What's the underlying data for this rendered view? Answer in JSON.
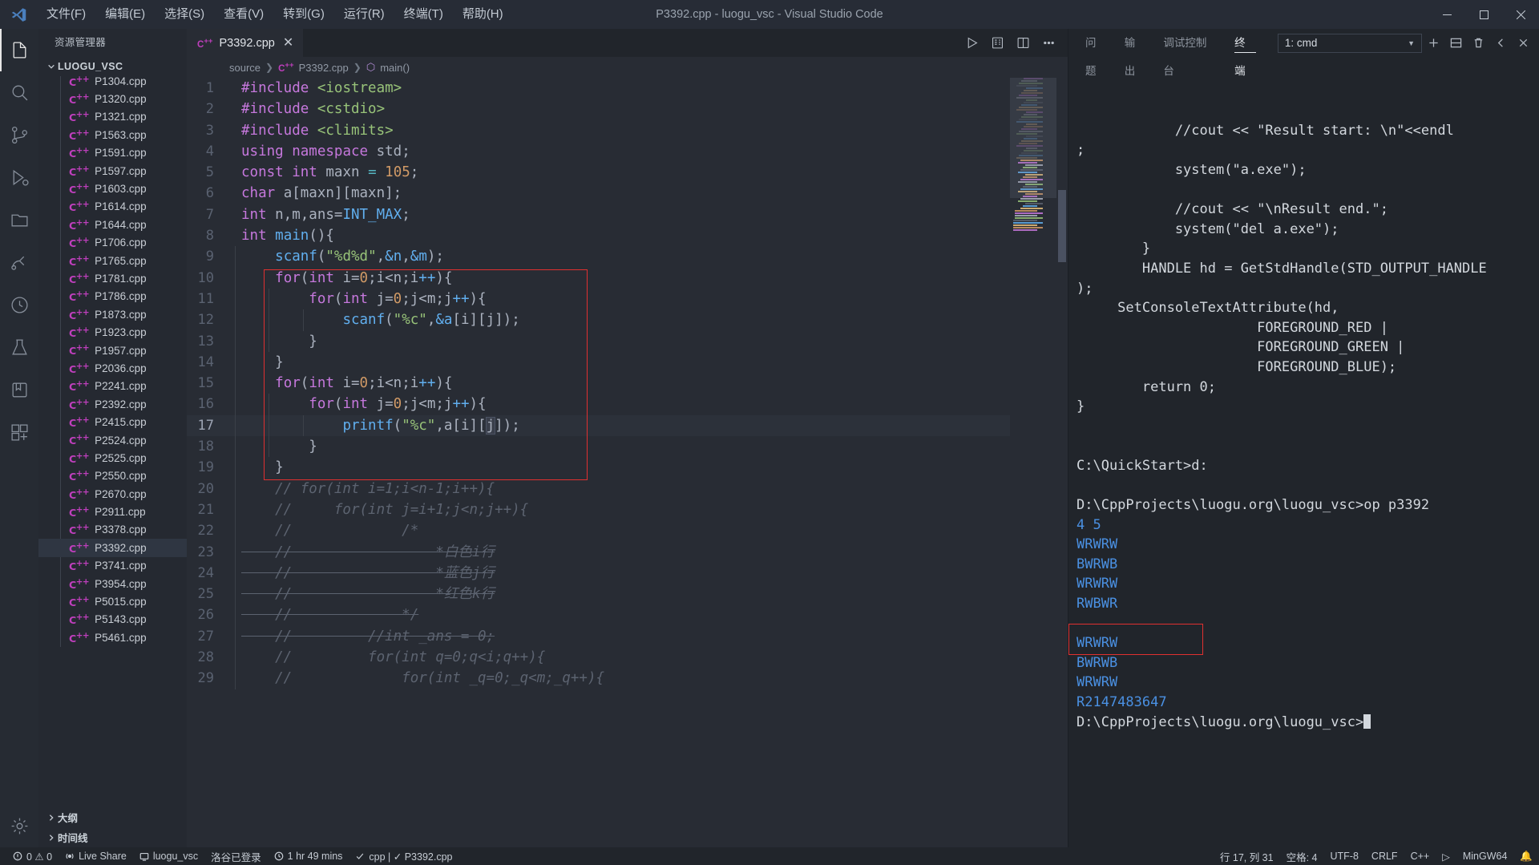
{
  "titlebar": {
    "title": "P3392.cpp - luogu_vsc - Visual Studio Code",
    "menus": [
      "文件(F)",
      "编辑(E)",
      "选择(S)",
      "查看(V)",
      "转到(G)",
      "运行(R)",
      "终端(T)",
      "帮助(H)"
    ],
    "window_controls": [
      "minimize",
      "maximize",
      "close"
    ]
  },
  "activitybar": {
    "items": [
      {
        "name": "explorer",
        "icon": "files-icon",
        "active": true
      },
      {
        "name": "search",
        "icon": "search-icon",
        "active": false
      },
      {
        "name": "source-control",
        "icon": "source-control-icon",
        "active": false
      },
      {
        "name": "run-debug",
        "icon": "run-debug-icon",
        "active": false
      },
      {
        "name": "remote-explorer",
        "icon": "folder-remote-icon",
        "active": false
      },
      {
        "name": "live-share",
        "icon": "live-share-icon",
        "active": false
      },
      {
        "name": "timeline",
        "icon": "clock-icon",
        "active": false
      },
      {
        "name": "testing",
        "icon": "beaker-icon",
        "active": false
      },
      {
        "name": "bookmarks",
        "icon": "bookmark-icon",
        "active": false
      },
      {
        "name": "extensions",
        "icon": "extensions-icon",
        "active": false
      },
      {
        "name": "settings",
        "icon": "gear-icon",
        "active": false
      }
    ]
  },
  "sidebar": {
    "title": "资源管理器",
    "root": "LUOGU_VSC",
    "files": [
      "P1304.cpp",
      "P1320.cpp",
      "P1321.cpp",
      "P1563.cpp",
      "P1591.cpp",
      "P1597.cpp",
      "P1603.cpp",
      "P1614.cpp",
      "P1644.cpp",
      "P1706.cpp",
      "P1765.cpp",
      "P1781.cpp",
      "P1786.cpp",
      "P1873.cpp",
      "P1923.cpp",
      "P1957.cpp",
      "P2036.cpp",
      "P2241.cpp",
      "P2392.cpp",
      "P2415.cpp",
      "P2524.cpp",
      "P2525.cpp",
      "P2550.cpp",
      "P2670.cpp",
      "P2911.cpp",
      "P3378.cpp",
      "P3392.cpp",
      "P3741.cpp",
      "P3954.cpp",
      "P5015.cpp",
      "P5143.cpp",
      "P5461.cpp"
    ],
    "selected_file": "P3392.cpp",
    "sections": [
      "大纲",
      "时间线"
    ]
  },
  "editor": {
    "tab": {
      "label": "P3392.cpp",
      "icon": "cpp-file-icon",
      "close": "✕"
    },
    "tab_actions": [
      "run-code-button",
      "split-preview-button",
      "split-editor-button",
      "more-actions-button"
    ],
    "breadcrumb": [
      "source",
      "P3392.cpp",
      "main()"
    ],
    "current_line_number": 17,
    "lines": [
      {
        "n": 1,
        "tokens": [
          {
            "t": "#include",
            "c": "pre"
          },
          {
            "t": " ",
            "c": "pl"
          },
          {
            "t": "<iostream>",
            "c": "str"
          }
        ]
      },
      {
        "n": 2,
        "tokens": [
          {
            "t": "#include",
            "c": "pre"
          },
          {
            "t": " ",
            "c": "pl"
          },
          {
            "t": "<cstdio>",
            "c": "str"
          }
        ]
      },
      {
        "n": 3,
        "tokens": [
          {
            "t": "#include",
            "c": "pre"
          },
          {
            "t": " ",
            "c": "pl"
          },
          {
            "t": "<climits>",
            "c": "str"
          }
        ]
      },
      {
        "n": 4,
        "tokens": [
          {
            "t": "using",
            "c": "k"
          },
          {
            "t": " ",
            "c": "pl"
          },
          {
            "t": "namespace",
            "c": "k"
          },
          {
            "t": " std;",
            "c": "pl"
          }
        ]
      },
      {
        "n": 5,
        "tokens": [
          {
            "t": "const",
            "c": "k"
          },
          {
            "t": " ",
            "c": "pl"
          },
          {
            "t": "int",
            "c": "k"
          },
          {
            "t": " maxn ",
            "c": "pl"
          },
          {
            "t": "=",
            "c": "op"
          },
          {
            "t": " ",
            "c": "pl"
          },
          {
            "t": "105",
            "c": "num"
          },
          {
            "t": ";",
            "c": "pl"
          }
        ]
      },
      {
        "n": 6,
        "tokens": [
          {
            "t": "char",
            "c": "k"
          },
          {
            "t": " a[maxn][maxn];",
            "c": "pl"
          }
        ]
      },
      {
        "n": 7,
        "tokens": [
          {
            "t": "int",
            "c": "k"
          },
          {
            "t": " n,m,ans=",
            "c": "pl"
          },
          {
            "t": "INT_MAX",
            "c": "fn"
          },
          {
            "t": ";",
            "c": "pl"
          }
        ]
      },
      {
        "n": 8,
        "tokens": [
          {
            "t": "int",
            "c": "k"
          },
          {
            "t": " ",
            "c": "pl"
          },
          {
            "t": "main",
            "c": "fn"
          },
          {
            "t": "(){",
            "c": "pl"
          }
        ]
      },
      {
        "n": 9,
        "tokens": [
          {
            "t": "    ",
            "c": "pl"
          },
          {
            "t": "scanf",
            "c": "fn"
          },
          {
            "t": "(",
            "c": "pl"
          },
          {
            "t": "\"%d%d\"",
            "c": "str"
          },
          {
            "t": ",",
            "c": "pl"
          },
          {
            "t": "&n",
            "c": "fn"
          },
          {
            "t": ",",
            "c": "pl"
          },
          {
            "t": "&m",
            "c": "fn"
          },
          {
            "t": ");",
            "c": "pl"
          }
        ]
      },
      {
        "n": 10,
        "tokens": [
          {
            "t": "    ",
            "c": "pl"
          },
          {
            "t": "for",
            "c": "k"
          },
          {
            "t": "(",
            "c": "pl"
          },
          {
            "t": "int",
            "c": "k"
          },
          {
            "t": " i=",
            "c": "pl"
          },
          {
            "t": "0",
            "c": "num"
          },
          {
            "t": ";i<n;i",
            "c": "pl"
          },
          {
            "t": "++",
            "c": "fn"
          },
          {
            "t": "){",
            "c": "pl"
          }
        ]
      },
      {
        "n": 11,
        "tokens": [
          {
            "t": "        ",
            "c": "pl"
          },
          {
            "t": "for",
            "c": "k"
          },
          {
            "t": "(",
            "c": "pl"
          },
          {
            "t": "int",
            "c": "k"
          },
          {
            "t": " j=",
            "c": "pl"
          },
          {
            "t": "0",
            "c": "num"
          },
          {
            "t": ";j<m;j",
            "c": "pl"
          },
          {
            "t": "++",
            "c": "fn"
          },
          {
            "t": "){",
            "c": "pl"
          }
        ]
      },
      {
        "n": 12,
        "tokens": [
          {
            "t": "            ",
            "c": "pl"
          },
          {
            "t": "scanf",
            "c": "fn"
          },
          {
            "t": "(",
            "c": "pl"
          },
          {
            "t": "\"%c\"",
            "c": "str"
          },
          {
            "t": ",",
            "c": "pl"
          },
          {
            "t": "&a",
            "c": "fn"
          },
          {
            "t": "[i][j]);",
            "c": "pl"
          }
        ]
      },
      {
        "n": 13,
        "tokens": [
          {
            "t": "        }",
            "c": "pl"
          }
        ]
      },
      {
        "n": 14,
        "tokens": [
          {
            "t": "    }",
            "c": "pl"
          }
        ]
      },
      {
        "n": 15,
        "tokens": [
          {
            "t": "    ",
            "c": "pl"
          },
          {
            "t": "for",
            "c": "k"
          },
          {
            "t": "(",
            "c": "pl"
          },
          {
            "t": "int",
            "c": "k"
          },
          {
            "t": " i=",
            "c": "pl"
          },
          {
            "t": "0",
            "c": "num"
          },
          {
            "t": ";i<n;i",
            "c": "pl"
          },
          {
            "t": "++",
            "c": "fn"
          },
          {
            "t": "){",
            "c": "pl"
          }
        ]
      },
      {
        "n": 16,
        "tokens": [
          {
            "t": "        ",
            "c": "pl"
          },
          {
            "t": "for",
            "c": "k"
          },
          {
            "t": "(",
            "c": "pl"
          },
          {
            "t": "int",
            "c": "k"
          },
          {
            "t": " j=",
            "c": "pl"
          },
          {
            "t": "0",
            "c": "num"
          },
          {
            "t": ";j<m;j",
            "c": "pl"
          },
          {
            "t": "++",
            "c": "fn"
          },
          {
            "t": "){",
            "c": "pl"
          }
        ]
      },
      {
        "n": 17,
        "tokens": [
          {
            "t": "            ",
            "c": "pl"
          },
          {
            "t": "printf",
            "c": "fn"
          },
          {
            "t": "(",
            "c": "pl"
          },
          {
            "t": "\"%c\"",
            "c": "str"
          },
          {
            "t": ",a[i][",
            "c": "pl"
          },
          {
            "t": "j",
            "c": "sel"
          },
          {
            "t": "]);",
            "c": "pl"
          }
        ]
      },
      {
        "n": 18,
        "tokens": [
          {
            "t": "        }",
            "c": "pl"
          }
        ]
      },
      {
        "n": 19,
        "tokens": [
          {
            "t": "    }",
            "c": "pl"
          }
        ]
      },
      {
        "n": 20,
        "tokens": [
          {
            "t": "    // for(int i=1;i<n-1;i++){",
            "c": "cm"
          }
        ]
      },
      {
        "n": 21,
        "tokens": [
          {
            "t": "    //     for(int j=i+1;j<n;j++){",
            "c": "cm"
          }
        ]
      },
      {
        "n": 22,
        "tokens": [
          {
            "t": "    //             /*",
            "c": "cm"
          }
        ]
      },
      {
        "n": 23,
        "tokens": [
          {
            "t": "    //                 *白色i行",
            "c": "cm-strike"
          }
        ]
      },
      {
        "n": 24,
        "tokens": [
          {
            "t": "    //                 *蓝色j行",
            "c": "cm-strike"
          }
        ]
      },
      {
        "n": 25,
        "tokens": [
          {
            "t": "    //                 *红色k行",
            "c": "cm-strike"
          }
        ]
      },
      {
        "n": 26,
        "tokens": [
          {
            "t": "    //             */",
            "c": "cm-strike"
          }
        ]
      },
      {
        "n": 27,
        "tokens": [
          {
            "t": "    //         //int _ans = 0;",
            "c": "cm-strike"
          }
        ]
      },
      {
        "n": 28,
        "tokens": [
          {
            "t": "    //         for(int q=0;q<i;q++){",
            "c": "cm"
          }
        ]
      },
      {
        "n": 29,
        "tokens": [
          {
            "t": "    //             for(int _q=0;_q<m;_q++){",
            "c": "cm"
          }
        ]
      }
    ]
  },
  "panel": {
    "tabs": [
      "问题",
      "输出",
      "调试控制台",
      "终端"
    ],
    "active_tab": "终端",
    "terminal_select": "1: cmd",
    "actions": [
      "new-terminal-button",
      "split-terminal-button",
      "kill-terminal-button",
      "chevron-left-button",
      "close-panel-button"
    ],
    "terminal_lines": [
      {
        "text": "            //cout << \"Result start: \\n\"<<endl",
        "color": "white"
      },
      {
        "text": ";",
        "color": "white"
      },
      {
        "text": "            system(\"a.exe\");",
        "color": "white"
      },
      {
        "text": "",
        "color": "white"
      },
      {
        "text": "            //cout << \"\\nResult end.\";",
        "color": "white"
      },
      {
        "text": "            system(\"del a.exe\");",
        "color": "white"
      },
      {
        "text": "        }",
        "color": "white"
      },
      {
        "text": "        HANDLE hd = GetStdHandle(STD_OUTPUT_HANDLE",
        "color": "white"
      },
      {
        "text": ");",
        "color": "white"
      },
      {
        "text": "     SetConsoleTextAttribute(hd,",
        "color": "white"
      },
      {
        "text": "                      FOREGROUND_RED |",
        "color": "white"
      },
      {
        "text": "                      FOREGROUND_GREEN |",
        "color": "white"
      },
      {
        "text": "                      FOREGROUND_BLUE);",
        "color": "white"
      },
      {
        "text": "        return 0;",
        "color": "white"
      },
      {
        "text": "}",
        "color": "white"
      },
      {
        "text": "",
        "color": "white"
      },
      {
        "text": "",
        "color": "white"
      },
      {
        "text": "C:\\QuickStart>d:",
        "color": "white"
      },
      {
        "text": "",
        "color": "white"
      },
      {
        "text": "D:\\CppProjects\\luogu.org\\luogu_vsc>op p3392",
        "color": "white"
      },
      {
        "text": "4 5",
        "color": "blue"
      },
      {
        "text": "WRWRW",
        "color": "blue"
      },
      {
        "text": "BWRWB",
        "color": "blue"
      },
      {
        "text": "WRWRW",
        "color": "blue"
      },
      {
        "text": "RWBWR",
        "color": "blue"
      },
      {
        "text": "",
        "color": "blue"
      },
      {
        "text": "WRWRW",
        "color": "blue"
      },
      {
        "text": "BWRWB",
        "color": "blue"
      },
      {
        "text": "WRWRW",
        "color": "blue"
      },
      {
        "text": "R2147483647",
        "color": "blue"
      },
      {
        "text": "D:\\CppProjects\\luogu.org\\luogu_vsc>",
        "color": "white",
        "cursor": true
      }
    ]
  },
  "statusbar": {
    "left": [
      {
        "name": "problems",
        "icon": "error-warning-icon",
        "text": "0 ⚠ 0"
      },
      {
        "name": "live-share",
        "icon": "broadcast-icon",
        "text": "Live Share"
      },
      {
        "name": "remote",
        "icon": "remote-icon",
        "text": "luogu_vsc"
      },
      {
        "name": "luogu-login",
        "icon": "account-icon",
        "text": "洛谷已登录"
      },
      {
        "name": "time-tracker",
        "icon": "clock-icon",
        "text": "1 hr 49 mins"
      },
      {
        "name": "cpp-check",
        "icon": "check-icon",
        "text": "cpp | ✓ P3392.cpp"
      }
    ],
    "right": [
      {
        "name": "cursor-position",
        "text": "行 17, 列 31"
      },
      {
        "name": "indentation",
        "text": "空格: 4"
      },
      {
        "name": "encoding",
        "text": "UTF-8"
      },
      {
        "name": "eol",
        "text": "CRLF"
      },
      {
        "name": "language-mode",
        "text": "C++"
      },
      {
        "name": "run-code",
        "text": "▷"
      },
      {
        "name": "compiler",
        "text": "MinGW64"
      },
      {
        "name": "notifications",
        "text": "🔔"
      }
    ]
  },
  "colors": {
    "accent": "#4a90e2",
    "redbox": "#e03030",
    "cpp_icon": "#bf3fbd",
    "bg_editor": "#282c34",
    "bg_panel": "#21252b"
  }
}
